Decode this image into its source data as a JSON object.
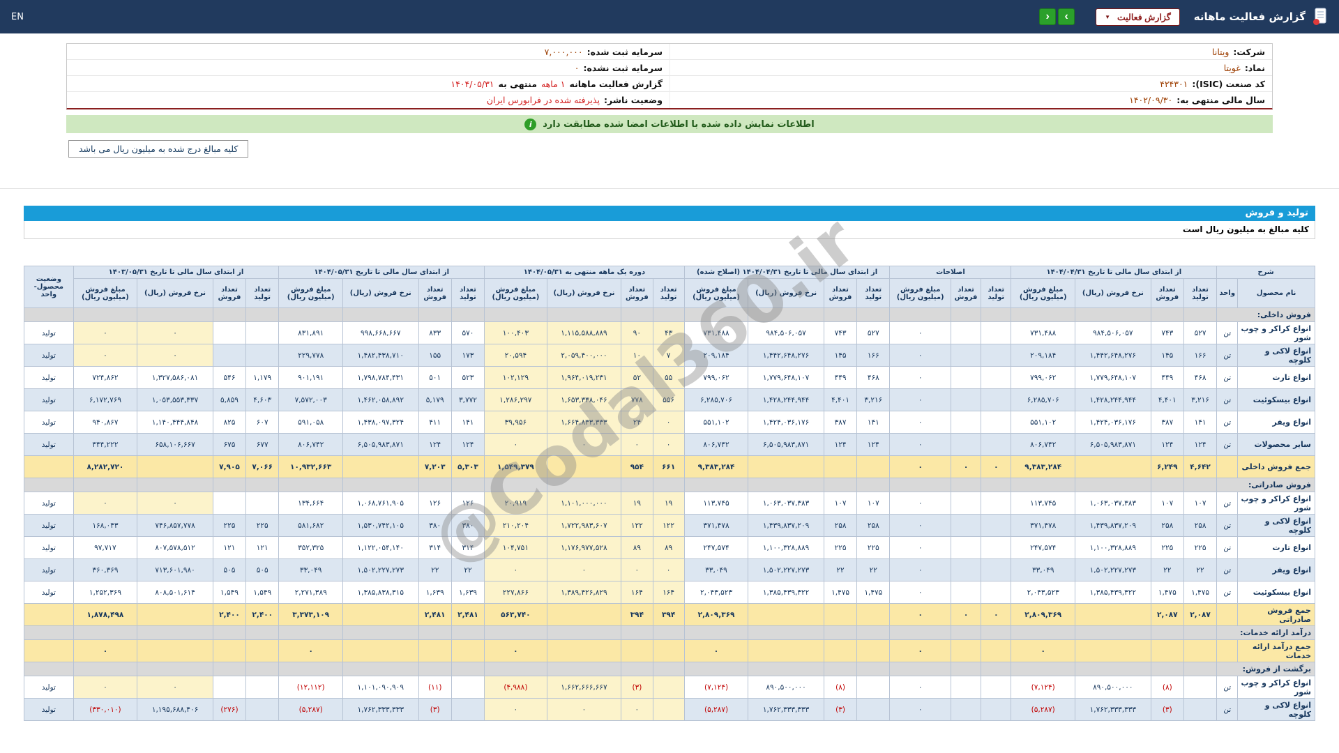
{
  "topbar": {
    "title": "گزارش فعالیت ماهانه",
    "dropdown": "گزارش فعالیت",
    "nav_right": "›",
    "nav_left": "‹",
    "lang": "EN"
  },
  "info": {
    "right": [
      [
        {
          "t": "شرکت:",
          "c": "lbl"
        },
        {
          "t": "ویتانا",
          "c": "val"
        }
      ],
      [
        {
          "t": "نماد:",
          "c": "lbl"
        },
        {
          "t": "غویتا",
          "c": "val"
        }
      ],
      [
        {
          "t": "کد صنعت (ISIC):",
          "c": "lbl"
        },
        {
          "t": "۴۲۴۳۰۱",
          "c": "val"
        }
      ],
      [
        {
          "t": "سال مالی منتهی به:",
          "c": "lbl"
        },
        {
          "t": "۱۴۰۲/۰۹/۳۰",
          "c": "val"
        }
      ]
    ],
    "left": [
      [
        {
          "t": "سرمایه ثبت شده:",
          "c": "lbl"
        },
        {
          "t": "۷,۰۰۰,۰۰۰",
          "c": "val"
        }
      ],
      [
        {
          "t": "سرمایه ثبت نشده:",
          "c": "lbl"
        },
        {
          "t": "۰",
          "c": "val"
        }
      ],
      [
        {
          "t": "گزارش فعالیت ماهانه",
          "c": "lbl"
        },
        {
          "t": "۱ ماهه",
          "c": "red"
        },
        {
          "t": "منتهی به",
          "c": "lbl"
        },
        {
          "t": "۱۴۰۴/۰۵/۳۱",
          "c": "red"
        }
      ],
      [
        {
          "t": "وضعیت ناشر:",
          "c": "lbl"
        },
        {
          "t": "پذیرفته شده در فرابورس ایران",
          "c": "red"
        }
      ]
    ]
  },
  "notice": "اطلاعات نمایش داده شده با اطلاعات امضا شده مطابقت دارد",
  "amounts_note": "کلیه مبالغ درج شده به میلیون ریال می باشد",
  "section_title": "تولید و فروش",
  "amounts_subtitle": "کلیه مبالغ به میلیون ریال است",
  "watermark": "@Codal360.ir",
  "table": {
    "corner_top": "شرح",
    "product_col": "نام محصول",
    "unit_col": "واحد",
    "status_col": "وضعیت محصول-واحد",
    "groups": [
      {
        "title": "از ابتدای سال مالی تا تاریخ ۱۴۰۴/۰۴/۳۱",
        "cols": [
          "تعداد تولید",
          "تعداد فروش",
          "نرخ فروش (ریال)",
          "مبلغ فروش (میلیون ریال)"
        ]
      },
      {
        "title": "اصلاحات",
        "cols": [
          "تعداد تولید",
          "تعداد فروش",
          "مبلغ فروش (میلیون ریال)"
        ]
      },
      {
        "title": "از ابتدای سال مالی تا تاریخ ۱۴۰۴/۰۴/۳۱ (اصلاح شده)",
        "cols": [
          "تعداد تولید",
          "تعداد فروش",
          "نرخ فروش (ریال)",
          "مبلغ فروش (میلیون ریال)"
        ]
      },
      {
        "title": "دوره یک ماهه منتهی به ۱۴۰۴/۰۵/۳۱",
        "cols": [
          "تعداد تولید",
          "تعداد فروش",
          "نرخ فروش (ریال)",
          "مبلغ فروش (میلیون ریال)"
        ]
      },
      {
        "title": "از ابتدای سال مالی تا تاریخ ۱۴۰۴/۰۵/۳۱",
        "cols": [
          "تعداد تولید",
          "تعداد فروش",
          "نرخ فروش (ریال)",
          "مبلغ فروش (میلیون ریال)"
        ]
      },
      {
        "title": "از ابتدای سال مالی تا تاریخ ۱۴۰۳/۰۵/۳۱",
        "cols": [
          "تعداد تولید",
          "تعداد فروش",
          "نرخ فروش (ریال)",
          "مبلغ فروش (میلیون ریال)"
        ]
      }
    ],
    "rows": [
      {
        "type": "section",
        "name": "فروش داخلی:"
      },
      {
        "type": "product",
        "name": "انواع کراکر و چوب شور",
        "unit": "تن",
        "status": "تولید",
        "hl": [
          21,
          22
        ],
        "cells": [
          "۵۲۷",
          "۷۴۳",
          "۹۸۴,۵۰۶,۰۵۷",
          "۷۳۱,۴۸۸",
          "",
          "",
          "۰",
          "۵۲۷",
          "۷۴۳",
          "۹۸۴,۵۰۶,۰۵۷",
          "۷۳۱,۴۸۸",
          "۴۳",
          "۹۰",
          "۱,۱۱۵,۵۸۸,۸۸۹",
          "۱۰۰,۴۰۳",
          "۵۷۰",
          "۸۳۳",
          "۹۹۸,۶۶۸,۶۶۷",
          "۸۳۱,۸۹۱",
          "",
          "",
          "۰",
          "۰"
        ]
      },
      {
        "type": "product",
        "name": "انواع لاکی و کلوچه",
        "unit": "تن",
        "status": "تولید",
        "hl": [
          21,
          22
        ],
        "cells": [
          "۱۶۶",
          "۱۴۵",
          "۱,۴۴۲,۶۴۸,۲۷۶",
          "۲۰۹,۱۸۴",
          "",
          "",
          "۰",
          "۱۶۶",
          "۱۴۵",
          "۱,۴۴۲,۶۴۸,۲۷۶",
          "۲۰۹,۱۸۴",
          "۷",
          "۱۰",
          "۲,۰۵۹,۴۰۰,۰۰۰",
          "۲۰,۵۹۴",
          "۱۷۳",
          "۱۵۵",
          "۱,۴۸۲,۴۳۸,۷۱۰",
          "۲۲۹,۷۷۸",
          "",
          "",
          "۰",
          "۰"
        ]
      },
      {
        "type": "product",
        "name": "انواع تارت",
        "unit": "تن",
        "status": "تولید",
        "cells": [
          "۴۶۸",
          "۴۴۹",
          "۱,۷۷۹,۶۴۸,۱۰۷",
          "۷۹۹,۰۶۲",
          "",
          "",
          "۰",
          "۴۶۸",
          "۴۴۹",
          "۱,۷۷۹,۶۴۸,۱۰۷",
          "۷۹۹,۰۶۲",
          "۵۵",
          "۵۲",
          "۱,۹۶۴,۰۱۹,۲۳۱",
          "۱۰۲,۱۲۹",
          "۵۲۳",
          "۵۰۱",
          "۱,۷۹۸,۷۸۴,۴۳۱",
          "۹۰۱,۱۹۱",
          "۱,۱۷۹",
          "۵۴۶",
          "۱,۳۲۷,۵۸۶,۰۸۱",
          "۷۲۴,۸۶۲"
        ]
      },
      {
        "type": "product",
        "name": "انواع بیسکوئیت",
        "unit": "تن",
        "status": "تولید",
        "cells": [
          "۳,۲۱۶",
          "۴,۴۰۱",
          "۱,۴۲۸,۲۴۴,۹۴۴",
          "۶,۲۸۵,۷۰۶",
          "",
          "",
          "۰",
          "۳,۲۱۶",
          "۴,۴۰۱",
          "۱,۴۲۸,۲۴۴,۹۴۴",
          "۶,۲۸۵,۷۰۶",
          "۵۵۶",
          "۷۷۸",
          "۱,۶۵۳,۳۳۸,۰۴۶",
          "۱,۲۸۶,۲۹۷",
          "۳,۷۷۲",
          "۵,۱۷۹",
          "۱,۴۶۲,۰۵۸,۸۹۲",
          "۷,۵۷۲,۰۰۳",
          "۴,۶۰۳",
          "۵,۸۵۹",
          "۱,۰۵۳,۵۵۳,۳۳۷",
          "۶,۱۷۲,۷۶۹"
        ]
      },
      {
        "type": "product",
        "name": "انواع ویفر",
        "unit": "تن",
        "status": "تولید",
        "cells": [
          "۱۴۱",
          "۳۸۷",
          "۱,۴۲۴,۰۳۶,۱۷۶",
          "۵۵۱,۱۰۲",
          "",
          "",
          "۰",
          "۱۴۱",
          "۳۸۷",
          "۱,۴۲۴,۰۳۶,۱۷۶",
          "۵۵۱,۱۰۲",
          "۰",
          "۲۴",
          "۱,۶۶۴,۸۳۳,۳۳۳",
          "۳۹,۹۵۶",
          "۱۴۱",
          "۴۱۱",
          "۱,۴۳۸,۰۹۷,۳۲۴",
          "۵۹۱,۰۵۸",
          "۶۰۷",
          "۸۲۵",
          "۱,۱۴۰,۴۴۴,۸۴۸",
          "۹۴۰,۸۶۷"
        ]
      },
      {
        "type": "product",
        "name": "سایر محصولات",
        "unit": "تن",
        "status": "تولید",
        "cells": [
          "۱۲۴",
          "۱۲۴",
          "۶,۵۰۵,۹۸۳,۸۷۱",
          "۸۰۶,۷۴۲",
          "",
          "",
          "۰",
          "۱۲۴",
          "۱۲۴",
          "۶,۵۰۵,۹۸۳,۸۷۱",
          "۸۰۶,۷۴۲",
          "۰",
          "۰",
          "۰",
          "۰",
          "۱۲۴",
          "۱۲۴",
          "۶,۵۰۵,۹۸۳,۸۷۱",
          "۸۰۶,۷۴۲",
          "۶۷۷",
          "۶۷۵",
          "۶۵۸,۱۰۶,۶۶۷",
          "۴۴۴,۲۲۲"
        ]
      },
      {
        "type": "total",
        "name": "جمع فروش داخلی",
        "unit": "",
        "status": "",
        "cells": [
          "۴,۶۴۲",
          "۶,۲۴۹",
          "",
          "۹,۳۸۳,۲۸۴",
          "۰",
          "۰",
          "۰",
          "",
          "",
          "",
          "۹,۳۸۳,۲۸۴",
          "۶۶۱",
          "۹۵۴",
          "",
          "۱,۵۴۹,۳۷۹",
          "۵,۳۰۳",
          "۷,۲۰۳",
          "",
          "۱۰,۹۳۲,۶۶۳",
          "۷,۰۶۶",
          "۷,۹۰۵",
          "",
          "۸,۲۸۲,۷۲۰"
        ]
      },
      {
        "type": "section",
        "name": "فروش صادراتی:"
      },
      {
        "type": "product",
        "name": "انواع کراکر و چوب شور",
        "unit": "تن",
        "status": "تولید",
        "hl": [
          21,
          22
        ],
        "cells": [
          "۱۰۷",
          "۱۰۷",
          "۱,۰۶۳,۰۳۷,۳۸۳",
          "۱۱۳,۷۴۵",
          "",
          "",
          "۰",
          "۱۰۷",
          "۱۰۷",
          "۱,۰۶۳,۰۳۷,۳۸۳",
          "۱۱۳,۷۴۵",
          "۱۹",
          "۱۹",
          "۱,۱۰۱,۰۰۰,۰۰۰",
          "۲۰,۹۱۹",
          "۱۲۶",
          "۱۲۶",
          "۱,۰۶۸,۷۶۱,۹۰۵",
          "۱۳۴,۶۶۴",
          "",
          "",
          "۰",
          "۰"
        ]
      },
      {
        "type": "product",
        "name": "انواع لاکی و کلوچه",
        "unit": "تن",
        "status": "تولید",
        "cells": [
          "۲۵۸",
          "۲۵۸",
          "۱,۴۳۹,۸۳۷,۲۰۹",
          "۳۷۱,۴۷۸",
          "",
          "",
          "۰",
          "۲۵۸",
          "۲۵۸",
          "۱,۴۳۹,۸۳۷,۲۰۹",
          "۳۷۱,۴۷۸",
          "۱۲۲",
          "۱۲۲",
          "۱,۷۲۲,۹۸۳,۶۰۷",
          "۲۱۰,۲۰۴",
          "۳۸۰",
          "۳۸۰",
          "۱,۵۳۰,۷۴۲,۱۰۵",
          "۵۸۱,۶۸۲",
          "۲۲۵",
          "۲۲۵",
          "۷۴۶,۸۵۷,۷۷۸",
          "۱۶۸,۰۴۳"
        ]
      },
      {
        "type": "product",
        "name": "انواع تارت",
        "unit": "تن",
        "status": "تولید",
        "cells": [
          "۲۲۵",
          "۲۲۵",
          "۱,۱۰۰,۳۲۸,۸۸۹",
          "۲۴۷,۵۷۴",
          "",
          "",
          "۰",
          "۲۲۵",
          "۲۲۵",
          "۱,۱۰۰,۳۲۸,۸۸۹",
          "۲۴۷,۵۷۴",
          "۸۹",
          "۸۹",
          "۱,۱۷۶,۹۷۷,۵۲۸",
          "۱۰۴,۷۵۱",
          "۳۱۴",
          "۳۱۴",
          "۱,۱۲۲,۰۵۴,۱۴۰",
          "۳۵۲,۳۲۵",
          "۱۲۱",
          "۱۲۱",
          "۸۰۷,۵۷۸,۵۱۲",
          "۹۷,۷۱۷"
        ]
      },
      {
        "type": "product",
        "name": "انواع ویفر",
        "unit": "تن",
        "status": "تولید",
        "cells": [
          "۲۲",
          "۲۲",
          "۱,۵۰۲,۲۲۷,۲۷۳",
          "۳۳,۰۴۹",
          "",
          "",
          "۰",
          "۲۲",
          "۲۲",
          "۱,۵۰۲,۲۲۷,۲۷۳",
          "۳۳,۰۴۹",
          "۰",
          "۰",
          "۰",
          "۰",
          "۲۲",
          "۲۲",
          "۱,۵۰۲,۲۲۷,۲۷۳",
          "۳۳,۰۴۹",
          "۵۰۵",
          "۵۰۵",
          "۷۱۳,۶۰۱,۹۸۰",
          "۳۶۰,۳۶۹"
        ]
      },
      {
        "type": "product",
        "name": "انواع بیسکوئیت",
        "unit": "تن",
        "status": "تولید",
        "cells": [
          "۱,۴۷۵",
          "۱,۴۷۵",
          "۱,۳۸۵,۴۳۹,۳۲۲",
          "۲,۰۴۳,۵۲۳",
          "",
          "",
          "۰",
          "۱,۴۷۵",
          "۱,۴۷۵",
          "۱,۳۸۵,۴۳۹,۳۲۲",
          "۲,۰۴۳,۵۲۳",
          "۱۶۴",
          "۱۶۴",
          "۱,۳۸۹,۴۲۶,۸۲۹",
          "۲۲۷,۸۶۶",
          "۱,۶۳۹",
          "۱,۶۳۹",
          "۱,۳۸۵,۸۳۸,۳۱۵",
          "۲,۲۷۱,۳۸۹",
          "۱,۵۴۹",
          "۱,۵۴۹",
          "۸۰۸,۵۰۱,۶۱۴",
          "۱,۲۵۲,۳۶۹"
        ]
      },
      {
        "type": "total",
        "name": "جمع فروش صادراتی",
        "unit": "",
        "status": "",
        "cells": [
          "۲,۰۸۷",
          "۲,۰۸۷",
          "",
          "۲,۸۰۹,۳۶۹",
          "۰",
          "۰",
          "۰",
          "",
          "",
          "",
          "۲,۸۰۹,۳۶۹",
          "۳۹۴",
          "۳۹۴",
          "",
          "۵۶۳,۷۴۰",
          "۲,۴۸۱",
          "۲,۴۸۱",
          "",
          "۳,۳۷۳,۱۰۹",
          "۲,۴۰۰",
          "۲,۴۰۰",
          "",
          "۱,۸۷۸,۴۹۸"
        ]
      },
      {
        "type": "section",
        "name": "درآمد ارائه خدمات:"
      },
      {
        "type": "total",
        "name": "جمع درآمد ارائه خدمات",
        "unit": "",
        "status": "",
        "cells": [
          "",
          "",
          "",
          "۰",
          "",
          "",
          "۰",
          "",
          "",
          "",
          "۰",
          "",
          "",
          "",
          "۰",
          "",
          "",
          "",
          "۰",
          "",
          "",
          "",
          "۰"
        ]
      },
      {
        "type": "section",
        "name": "برگشت از فروش:"
      },
      {
        "type": "product",
        "name": "انواع کراکر و چوب شور",
        "unit": "تن",
        "status": "تولید",
        "hl": [
          21,
          22
        ],
        "cells": [
          "",
          "(۸)",
          "۸۹۰,۵۰۰,۰۰۰",
          "(۷,۱۲۴)",
          "",
          "",
          "۰",
          "",
          "(۸)",
          "۸۹۰,۵۰۰,۰۰۰",
          "(۷,۱۲۴)",
          "",
          "(۳)",
          "۱,۶۶۲,۶۶۶,۶۶۷",
          "(۴,۹۸۸)",
          "",
          "(۱۱)",
          "۱,۱۰۱,۰۹۰,۹۰۹",
          "(۱۲,۱۱۲)",
          "",
          "",
          "۰",
          "۰"
        ]
      },
      {
        "type": "product",
        "name": "انواع لاکی و کلوچه",
        "unit": "تن",
        "status": "تولید",
        "cells": [
          "",
          "(۳)",
          "۱,۷۶۲,۳۳۳,۳۳۳",
          "(۵,۲۸۷)",
          "",
          "",
          "۰",
          "",
          "(۳)",
          "۱,۷۶۲,۳۳۳,۳۳۳",
          "(۵,۲۸۷)",
          "",
          "۰",
          "۰",
          "۰",
          "",
          "(۳)",
          "۱,۷۶۲,۳۳۳,۳۳۳",
          "(۵,۲۸۷)",
          "",
          "(۲۷۶)",
          "۱,۱۹۵,۶۸۸,۴۰۶",
          "(۳۳۰,۰۱۰)"
        ]
      }
    ]
  }
}
